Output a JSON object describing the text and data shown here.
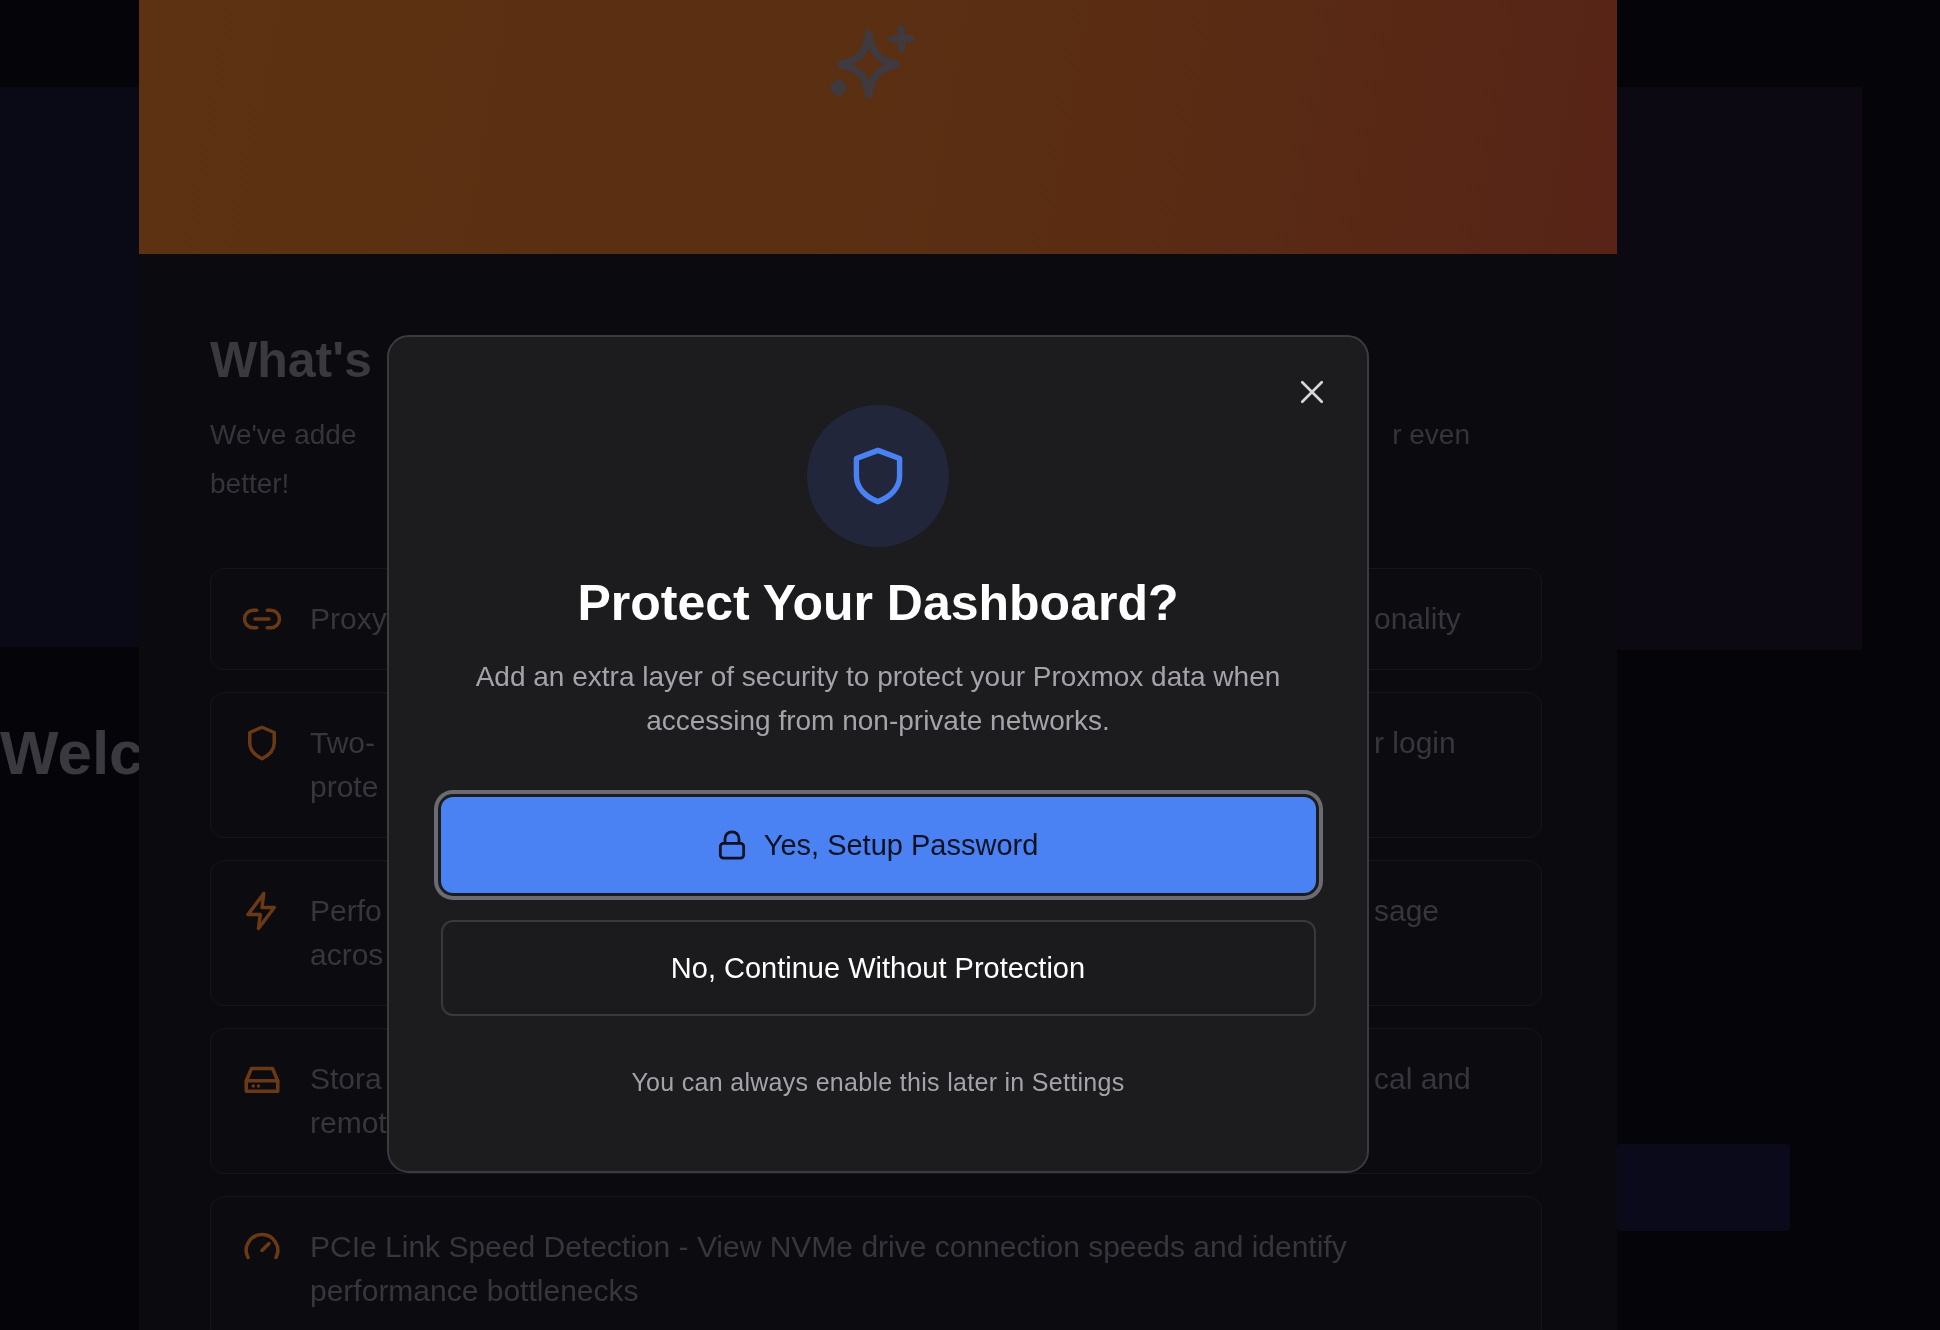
{
  "background": {
    "welcome_heading": "Welc",
    "whats_new": {
      "title": "What's",
      "description_left": [
        "We've adde",
        "better!"
      ],
      "description_right": "r even",
      "features": [
        {
          "kind": "link",
          "left": [
            "Proxy"
          ],
          "right": "onality"
        },
        {
          "kind": "shield",
          "left": [
            "Two-",
            "prote"
          ],
          "right": "r login"
        },
        {
          "kind": "bolt",
          "left": [
            "Perfo",
            "acros"
          ],
          "right": "sage"
        },
        {
          "kind": "drive",
          "left": [
            "Stora",
            "remot"
          ],
          "right": "cal and"
        },
        {
          "kind": "gauge",
          "left": [
            "PCIe Link Speed Detection - View NVMe drive connection speeds and identify",
            "performance bottlenecks"
          ]
        }
      ]
    }
  },
  "dialog": {
    "title": "Protect Your Dashboard?",
    "description": "Add an extra layer of security to protect your Proxmox data when accessing from non-private networks.",
    "buttons": [
      {
        "kind": "primary",
        "label": "Yes, Setup Password"
      },
      {
        "kind": "secondary",
        "label": "No, Continue Without Protection"
      }
    ],
    "footnote": "You can always enable this later in Settings"
  }
}
